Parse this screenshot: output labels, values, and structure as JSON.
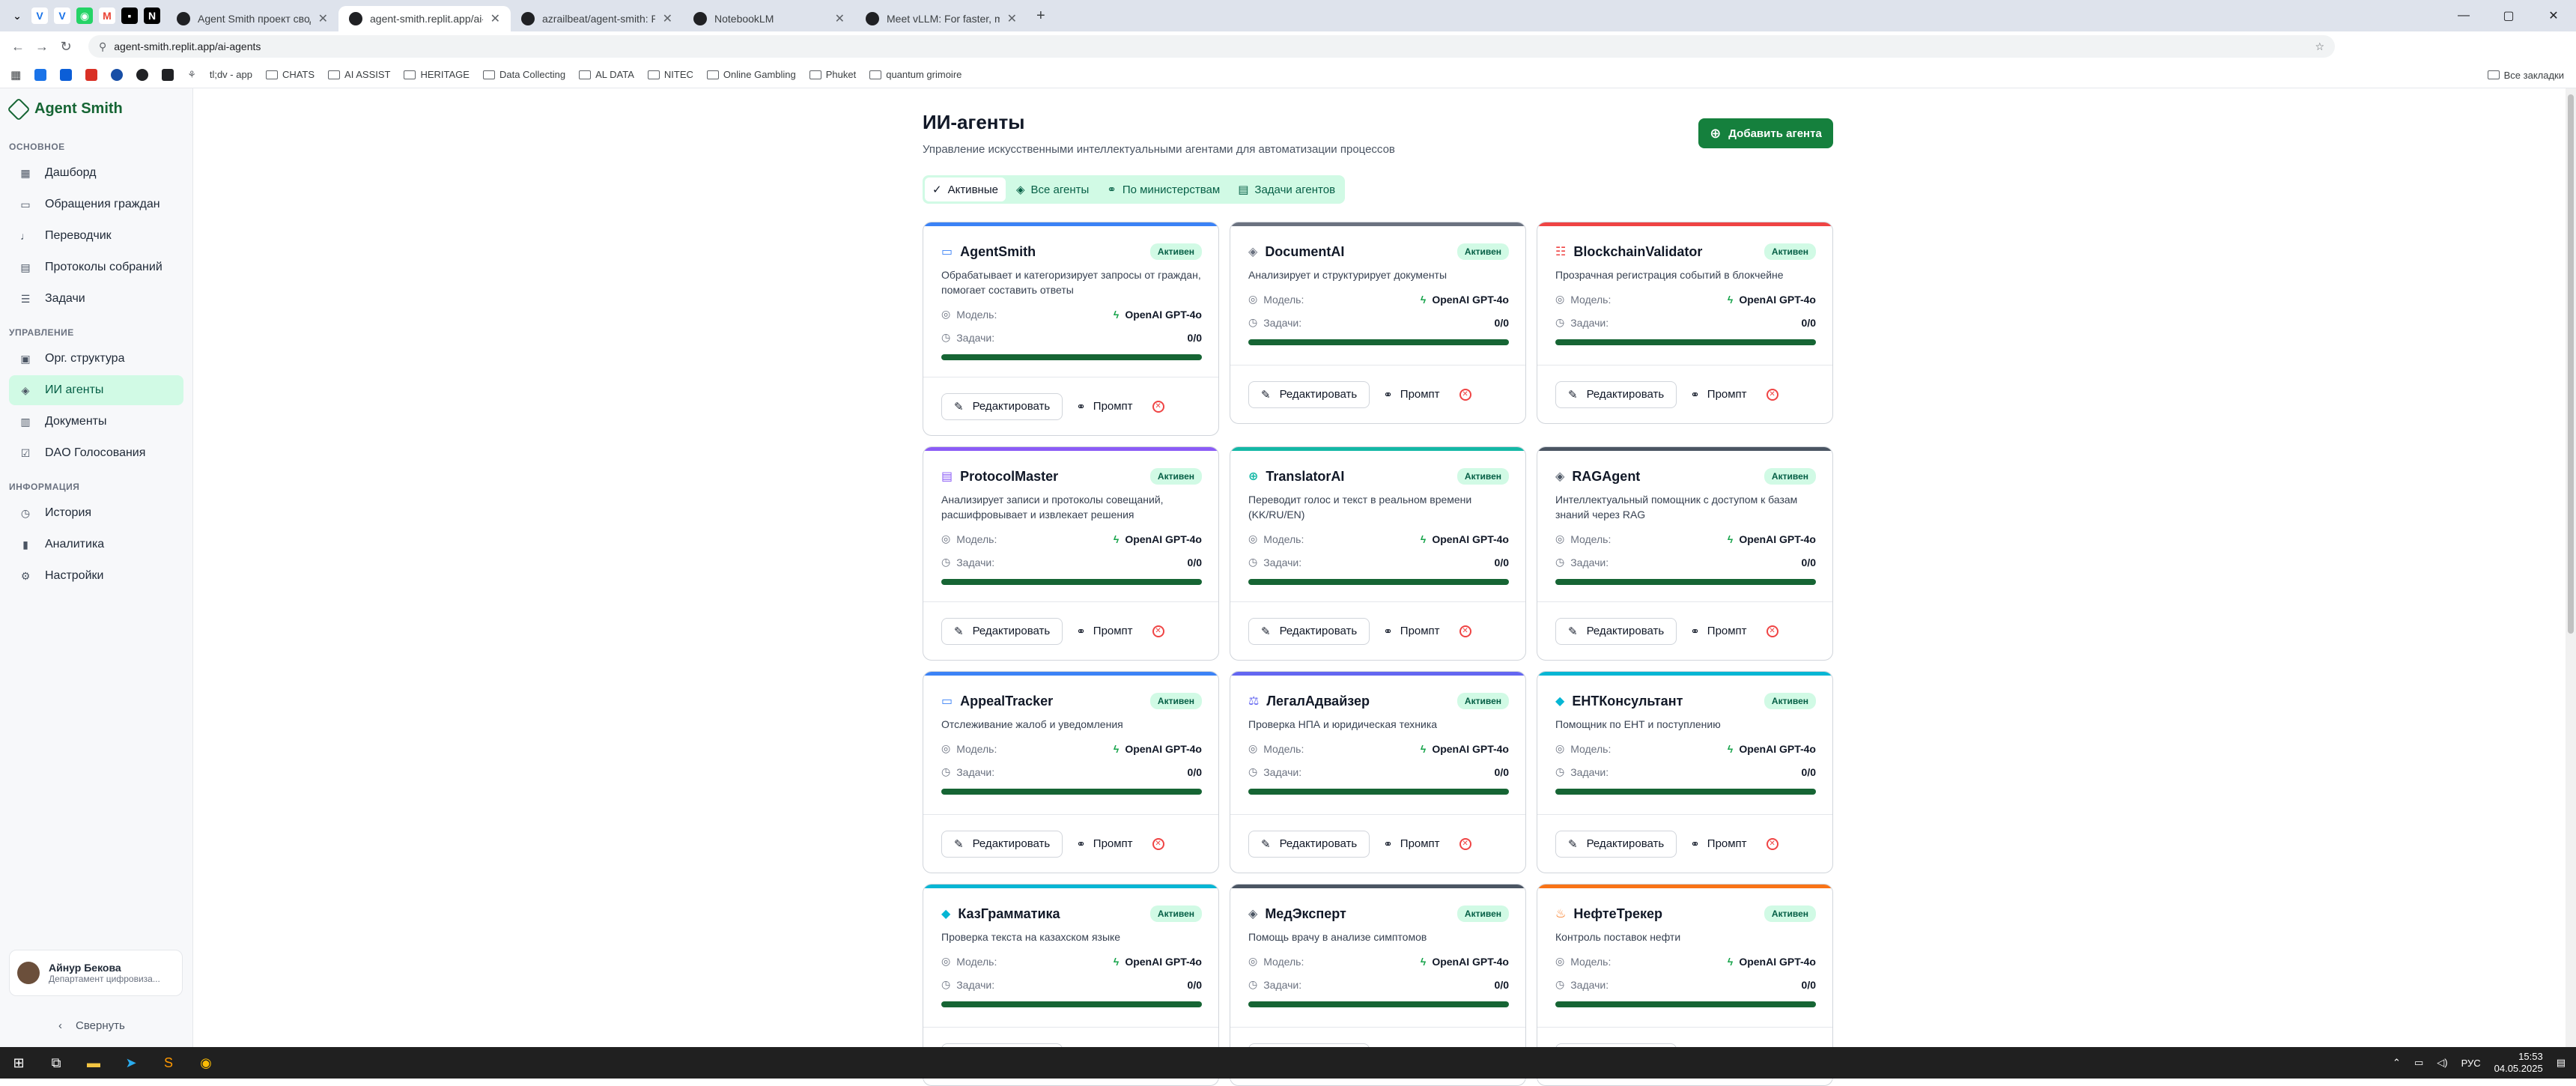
{
  "browser": {
    "tabs": [
      {
        "label": "Agent Smith проект сводка",
        "active": false
      },
      {
        "label": "agent-smith.replit.app/ai-agen",
        "active": true
      },
      {
        "label": "azrailbeat/agent-smith: Platfo",
        "active": false
      },
      {
        "label": "NotebookLM",
        "active": false
      },
      {
        "label": "Meet vLLM: For faster, more effi",
        "active": false
      }
    ],
    "url": "agent-smith.replit.app/ai-agents",
    "bookmarks": [
      "tl;dv - app",
      "CHATS",
      "AI ASSIST",
      "HERITAGE",
      "Data Collecting",
      "AL DATA",
      "NITEC",
      "Online Gambling",
      "Phuket",
      "quantum grimoire"
    ],
    "all_bookmarks": "Все закладки"
  },
  "sidebar": {
    "brand": "Agent Smith",
    "sections": [
      {
        "title": "ОСНОВНОЕ",
        "items": [
          {
            "label": "Дашборд",
            "icon": "grid-icon"
          },
          {
            "label": "Обращения граждан",
            "icon": "message-icon"
          },
          {
            "label": "Переводчик",
            "icon": "mic-icon"
          },
          {
            "label": "Протоколы собраний",
            "icon": "document-icon"
          },
          {
            "label": "Задачи",
            "icon": "list-icon"
          }
        ]
      },
      {
        "title": "УПРАВЛЕНИЕ",
        "items": [
          {
            "label": "Орг. структура",
            "icon": "building-icon"
          },
          {
            "label": "ИИ агенты",
            "icon": "bot-icon",
            "active": true
          },
          {
            "label": "Документы",
            "icon": "file-icon"
          },
          {
            "label": "DAO Голосования",
            "icon": "vote-icon"
          }
        ]
      },
      {
        "title": "ИНФОРМАЦИЯ",
        "items": [
          {
            "label": "История",
            "icon": "clock-icon"
          },
          {
            "label": "Аналитика",
            "icon": "chart-icon"
          },
          {
            "label": "Настройки",
            "icon": "gear-icon"
          }
        ]
      }
    ],
    "user": {
      "name": "Айнур Бекова",
      "dept": "Департамент цифровиза..."
    },
    "collapse": "Свернуть"
  },
  "page": {
    "title": "ИИ-агенты",
    "subtitle": "Управление искусственными интеллектуальными агентами для автоматизации процессов",
    "add_button": "Добавить агента",
    "tabs": [
      "Активные",
      "Все агенты",
      "По министерствам",
      "Задачи агентов"
    ]
  },
  "card_labels": {
    "status": "Активен",
    "model": "Модель:",
    "tasks": "Задачи:",
    "edit": "Редактировать",
    "prompt": "Промпт"
  },
  "agents": [
    {
      "name": "AgentSmith",
      "desc": "Обрабатывает и категоризирует запросы от граждан, помогает составить ответы",
      "model": "OpenAI GPT-4o",
      "tasks": "0/0",
      "progress": 1.0,
      "color": "#3b82f6",
      "icon": "message-icon"
    },
    {
      "name": "DocumentAI",
      "desc": "Анализирует и структурирует документы",
      "model": "OpenAI GPT-4o",
      "tasks": "0/0",
      "progress": 1.0,
      "color": "#6b7280",
      "icon": "bot-icon"
    },
    {
      "name": "BlockchainValidator",
      "desc": "Прозрачная регистрация событий в блокчейне",
      "model": "OpenAI GPT-4o",
      "tasks": "0/0",
      "progress": 1.0,
      "color": "#ef4444",
      "icon": "database-icon"
    },
    {
      "name": "ProtocolMaster",
      "desc": "Анализирует записи и протоколы совещаний, расшифровывает и извлекает решения",
      "model": "OpenAI GPT-4o",
      "tasks": "0/0",
      "progress": 1.0,
      "color": "#8b5cf6",
      "icon": "document-icon"
    },
    {
      "name": "TranslatorAI",
      "desc": "Переводит голос и текст в реальном времени (KK/RU/EN)",
      "model": "OpenAI GPT-4o",
      "tasks": "0/0",
      "progress": 1.0,
      "color": "#14b8a6",
      "icon": "globe-icon"
    },
    {
      "name": "RAGAgent",
      "desc": "Интеллектуальный помощник с доступом к базам знаний через RAG",
      "model": "OpenAI GPT-4o",
      "tasks": "0/0",
      "progress": 1.0,
      "color": "#4b5563",
      "icon": "bot-icon"
    },
    {
      "name": "AppealTracker",
      "desc": "Отслеживание жалоб и уведомления",
      "model": "OpenAI GPT-4o",
      "tasks": "0/0",
      "progress": 1.0,
      "color": "#3b82f6",
      "icon": "message-icon"
    },
    {
      "name": "ЛегалАдвайзер",
      "desc": "Проверка НПА и юридическая техника",
      "model": "OpenAI GPT-4o",
      "tasks": "0/0",
      "progress": 1.0,
      "color": "#6366f1",
      "icon": "scale-icon"
    },
    {
      "name": "ЕНТКонсультант",
      "desc": "Помощник по ЕНТ и поступлению",
      "model": "OpenAI GPT-4o",
      "tasks": "0/0",
      "progress": 1.0,
      "color": "#06b6d4",
      "icon": "graduation-icon"
    },
    {
      "name": "КазГрамматика",
      "desc": "Проверка текста на казахском языке",
      "model": "OpenAI GPT-4o",
      "tasks": "0/0",
      "progress": 1.0,
      "color": "#06b6d4",
      "icon": "graduation-icon"
    },
    {
      "name": "МедЭксперт",
      "desc": "Помощь врачу в анализе симптомов",
      "model": "OpenAI GPT-4o",
      "tasks": "0/0",
      "progress": 1.0,
      "color": "#4b5563",
      "icon": "bot-icon"
    },
    {
      "name": "НефтеТрекер",
      "desc": "Контроль поставок нефти",
      "model": "OpenAI GPT-4o",
      "tasks": "0/0",
      "progress": 1.0,
      "color": "#f97316",
      "icon": "flame-icon"
    }
  ],
  "taskbar": {
    "lang": "РУС",
    "time": "15:53",
    "date": "04.05.2025"
  }
}
